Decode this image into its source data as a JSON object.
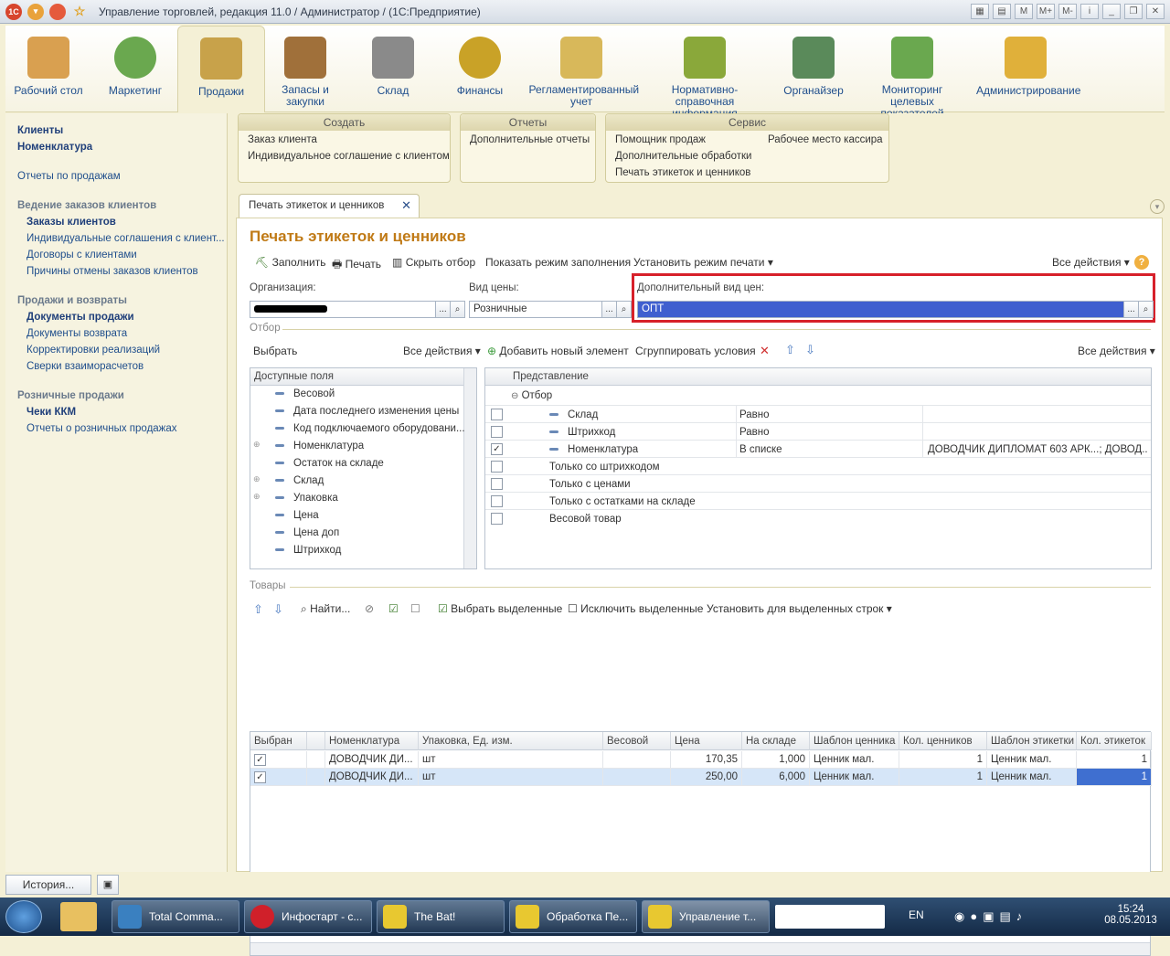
{
  "window": {
    "title": "Управление торговлей, редакция 11.0 / Администратор / (1С:Предприятие)",
    "logo": "1C"
  },
  "sections": [
    {
      "label": "Рабочий стол",
      "color": "#d9a050"
    },
    {
      "label": "Маркетинг",
      "color": "#6aa84f"
    },
    {
      "label": "Продажи",
      "color": "#c8a24a"
    },
    {
      "label": "Запасы и закупки",
      "color": "#a0703a"
    },
    {
      "label": "Склад",
      "color": "#8a8a8a"
    },
    {
      "label": "Финансы",
      "color": "#c9a227"
    },
    {
      "label": "Регламентированный учет",
      "color": "#d8b85a"
    },
    {
      "label": "Нормативно-справочная информация",
      "color": "#8aa83a"
    },
    {
      "label": "Органайзер",
      "color": "#5a8a5a"
    },
    {
      "label": "Мониторинг целевых показателей",
      "color": "#6aa84f"
    },
    {
      "label": "Администрирование",
      "color": "#e0b03a"
    }
  ],
  "left": {
    "top": [
      "Клиенты",
      "Номенклатура"
    ],
    "reports": "Отчеты по продажам",
    "g1": {
      "title": "Ведение заказов клиентов",
      "items": [
        "Заказы клиентов",
        "Индивидуальные соглашения с клиент...",
        "Договоры с клиентами",
        "Причины отмены заказов клиентов"
      ]
    },
    "g2": {
      "title": "Продажи и возвраты",
      "items": [
        "Документы продажи",
        "Документы возврата",
        "Корректировки реализаций",
        "Сверки взаиморасчетов"
      ]
    },
    "g3": {
      "title": "Розничные продажи",
      "items": [
        "Чеки ККМ",
        "Отчеты о розничных продажах"
      ]
    }
  },
  "actions": {
    "create": {
      "title": "Создать",
      "items": [
        "Заказ клиента",
        "Индивидуальное соглашение с клиентом"
      ]
    },
    "reports": {
      "title": "Отчеты",
      "items": [
        "Дополнительные отчеты"
      ]
    },
    "service": {
      "title": "Сервис",
      "items": [
        "Помощник продаж",
        "Дополнительные обработки",
        "Печать этикеток и ценников",
        "Рабочее место кассира"
      ]
    }
  },
  "tab": {
    "label": "Печать этикеток и ценников",
    "close": "✕"
  },
  "form": {
    "title": "Печать этикеток и ценников",
    "toolbar": [
      "Заполнить",
      "Печать",
      "Скрыть отбор",
      "Показать режим заполнения",
      "Установить режим печати ▾"
    ],
    "all_actions": "Все действия ▾",
    "help": "?",
    "org_label": "Организация:",
    "org_value": "",
    "price_label": "Вид цены:",
    "price_value": "Розничные",
    "addprice_label": "Дополнительный вид цен:",
    "addprice_value": "ОПТ"
  },
  "filter": {
    "section": "Отбор",
    "choose": "Выбрать",
    "all_actions": "Все действия ▾",
    "toolbar": [
      "Добавить новый элемент",
      "Сгруппировать условия"
    ],
    "fields_header": "Доступные поля",
    "fields": [
      "Весовой",
      "Дата последнего изменения цены",
      "Код подключаемого оборудовани...",
      "Номенклатура",
      "Остаток на складе",
      "Склад",
      "Упаковка",
      "Цена",
      "Цена доп",
      "Штрихкод"
    ],
    "rep_header": "Представление",
    "root": "Отбор",
    "rows": [
      {
        "name": "Склад",
        "cond": "Равно",
        "value": "",
        "checked": ""
      },
      {
        "name": "Штрихкод",
        "cond": "Равно",
        "value": "",
        "checked": ""
      },
      {
        "name": "Номенклатура",
        "cond": "В списке",
        "value": "ДОВОДЧИК ДИПЛОМАТ 603 АРК...; ДОВОД...",
        "checked": "✓"
      },
      {
        "name": "Только со штрихкодом",
        "cond": "",
        "value": "",
        "checked": ""
      },
      {
        "name": "Только с ценами",
        "cond": "",
        "value": "",
        "checked": ""
      },
      {
        "name": "Только с остатками на складе",
        "cond": "",
        "value": "",
        "checked": ""
      },
      {
        "name": "Весовой товар",
        "cond": "",
        "value": "",
        "checked": ""
      }
    ]
  },
  "goods": {
    "section": "Товары",
    "toolbar": [
      "Найти...",
      "Выбрать выделенные",
      "Исключить выделенные",
      "Установить для выделенных строк ▾"
    ],
    "headers": [
      "Выбран",
      "Номенклатура",
      "Упаковка, Ед. изм.",
      "Весовой",
      "Цена",
      "На складе",
      "Шаблон ценника",
      "Кол. ценников",
      "Шаблон этикетки",
      "Кол. этикеток"
    ],
    "rows": [
      [
        "✓",
        "ДОВОДЧИК ДИ...",
        "шт",
        "",
        "170,35",
        "1,000",
        "Ценник мал.",
        "1",
        "Ценник мал.",
        "1"
      ],
      [
        "✓",
        "ДОВОДЧИК ДИ...",
        "шт",
        "",
        "250,00",
        "6,000",
        "Ценник мал.",
        "1",
        "Ценник мал.",
        "1"
      ]
    ]
  },
  "status": {
    "history": "История..."
  },
  "taskbar": {
    "items": [
      "Total Comma...",
      "Инфостарт - с...",
      "The Bat!",
      "Обработка Пе...",
      "Управление т..."
    ],
    "lang": "EN",
    "time": "15:24",
    "date": "08.05.2013"
  }
}
